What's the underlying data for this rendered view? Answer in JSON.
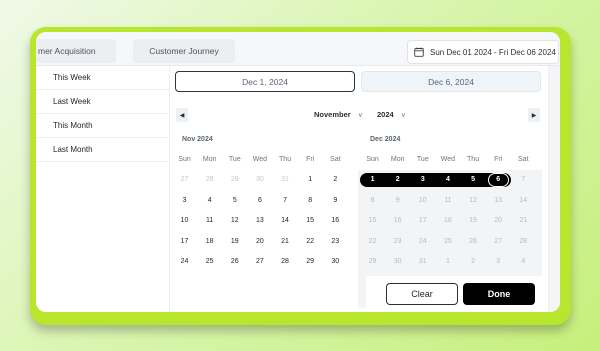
{
  "tabs": [
    "mer Acquisition",
    "Customer Journey"
  ],
  "date_range_display": "Sun Dec 01 2024 - Fri Dec 06 2024",
  "presets": [
    "This Week",
    "Last Week",
    "This Month",
    "Last Month"
  ],
  "inputs": {
    "start": "Dec 1, 2024",
    "end": "Dec 6, 2024"
  },
  "nav": {
    "month": "November",
    "year": "2024",
    "prev": "◀",
    "next": "▶",
    "chevron": "∨"
  },
  "weekdays": [
    "Sun",
    "Mon",
    "Tue",
    "Wed",
    "Thu",
    "Fri",
    "Sat"
  ],
  "months": [
    {
      "label": "Nov 2024",
      "weeks": [
        [
          {
            "d": "27",
            "s": "mut"
          },
          {
            "d": "28",
            "s": "mut"
          },
          {
            "d": "29",
            "s": "mut"
          },
          {
            "d": "30",
            "s": "mut"
          },
          {
            "d": "31",
            "s": "mut"
          },
          {
            "d": "1",
            "s": ""
          },
          {
            "d": "2",
            "s": ""
          }
        ],
        [
          {
            "d": "3",
            "s": ""
          },
          {
            "d": "4",
            "s": ""
          },
          {
            "d": "5",
            "s": ""
          },
          {
            "d": "6",
            "s": ""
          },
          {
            "d": "7",
            "s": ""
          },
          {
            "d": "8",
            "s": ""
          },
          {
            "d": "9",
            "s": ""
          }
        ],
        [
          {
            "d": "10",
            "s": ""
          },
          {
            "d": "11",
            "s": ""
          },
          {
            "d": "12",
            "s": ""
          },
          {
            "d": "13",
            "s": ""
          },
          {
            "d": "14",
            "s": ""
          },
          {
            "d": "15",
            "s": ""
          },
          {
            "d": "16",
            "s": ""
          }
        ],
        [
          {
            "d": "17",
            "s": ""
          },
          {
            "d": "18",
            "s": ""
          },
          {
            "d": "19",
            "s": ""
          },
          {
            "d": "20",
            "s": ""
          },
          {
            "d": "21",
            "s": ""
          },
          {
            "d": "22",
            "s": ""
          },
          {
            "d": "23",
            "s": ""
          }
        ],
        [
          {
            "d": "24",
            "s": ""
          },
          {
            "d": "25",
            "s": ""
          },
          {
            "d": "26",
            "s": ""
          },
          {
            "d": "27",
            "s": ""
          },
          {
            "d": "28",
            "s": ""
          },
          {
            "d": "29",
            "s": ""
          },
          {
            "d": "30",
            "s": ""
          }
        ]
      ]
    },
    {
      "label": "Dec 2024",
      "weeks": [
        [
          {
            "d": "1",
            "s": "selected"
          },
          {
            "d": "2",
            "s": "selected"
          },
          {
            "d": "3",
            "s": "selected"
          },
          {
            "d": "4",
            "s": "selected"
          },
          {
            "d": "5",
            "s": "selected"
          },
          {
            "d": "6",
            "s": "selected endday"
          },
          {
            "d": "7",
            "s": "dim"
          }
        ],
        [
          {
            "d": "8",
            "s": "dim"
          },
          {
            "d": "9",
            "s": "dim"
          },
          {
            "d": "10",
            "s": "dim"
          },
          {
            "d": "11",
            "s": "dim"
          },
          {
            "d": "12",
            "s": "dim"
          },
          {
            "d": "13",
            "s": "dim"
          },
          {
            "d": "14",
            "s": "dim"
          }
        ],
        [
          {
            "d": "15",
            "s": "dim"
          },
          {
            "d": "16",
            "s": "dim"
          },
          {
            "d": "17",
            "s": "dim"
          },
          {
            "d": "18",
            "s": "dim"
          },
          {
            "d": "19",
            "s": "dim"
          },
          {
            "d": "20",
            "s": "dim"
          },
          {
            "d": "21",
            "s": "dim"
          }
        ],
        [
          {
            "d": "22",
            "s": "dim"
          },
          {
            "d": "23",
            "s": "dim"
          },
          {
            "d": "24",
            "s": "dim"
          },
          {
            "d": "25",
            "s": "dim"
          },
          {
            "d": "26",
            "s": "dim"
          },
          {
            "d": "27",
            "s": "dim"
          },
          {
            "d": "28",
            "s": "dim"
          }
        ],
        [
          {
            "d": "29",
            "s": "dim"
          },
          {
            "d": "30",
            "s": "dim"
          },
          {
            "d": "31",
            "s": "dim"
          },
          {
            "d": "1",
            "s": "dim"
          },
          {
            "d": "2",
            "s": "dim"
          },
          {
            "d": "3",
            "s": "dim"
          },
          {
            "d": "4",
            "s": "dim"
          }
        ]
      ]
    }
  ],
  "buttons": {
    "clear": "Clear",
    "done": "Done"
  },
  "colors": {
    "frame": "#b8e62e",
    "selected": "#000000"
  }
}
